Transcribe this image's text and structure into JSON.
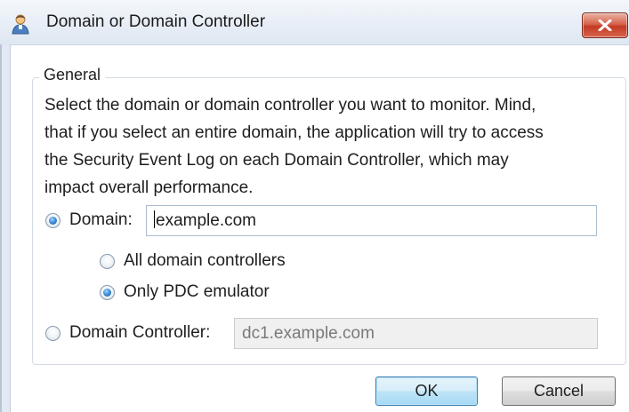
{
  "window": {
    "title": "Domain or Domain Controller",
    "close_label": "✕"
  },
  "group": {
    "label": "General",
    "description_lines": [
      "Select the domain or domain controller you want to monitor. Mind,",
      "that if you select an entire domain, the application will try to access",
      "the Security Event Log on each Domain Controller, which may",
      "impact overall performance."
    ]
  },
  "options": {
    "domain": {
      "label": "Domain:",
      "value": "example.com",
      "checked": true
    },
    "all_dcs": {
      "label": "All domain controllers",
      "checked": false
    },
    "pdc": {
      "label": "Only PDC emulator",
      "checked": true
    },
    "dc": {
      "label": "Domain Controller:",
      "value": "dc1.example.com",
      "checked": false,
      "enabled": false
    }
  },
  "buttons": {
    "ok": "OK",
    "cancel": "Cancel"
  },
  "colors": {
    "accent": "#3f8fd8",
    "close": "#c43b24"
  },
  "icons": {
    "app": "user-icon",
    "close": "close-icon"
  }
}
